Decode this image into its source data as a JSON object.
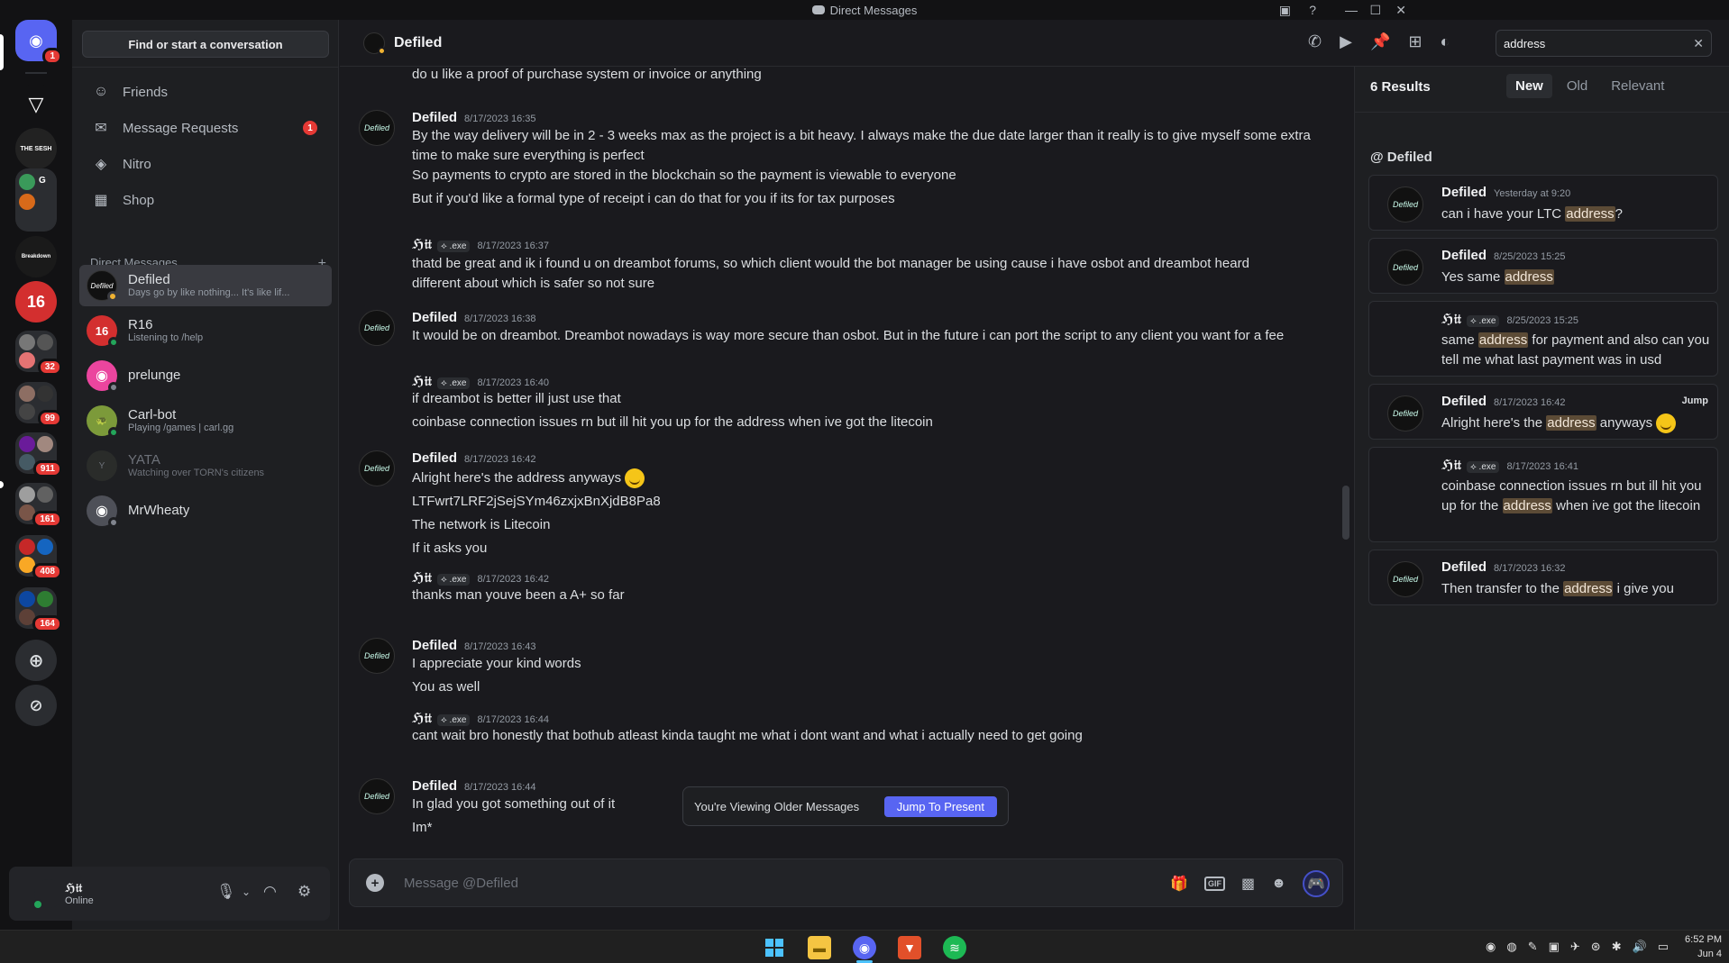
{
  "window": {
    "title": "Direct Messages"
  },
  "servers": [
    {
      "label": "THE SESH",
      "badge": ""
    },
    {
      "label": "G",
      "badge": ""
    },
    {
      "label": "Breakdown",
      "badge": ""
    },
    {
      "label": "16",
      "badge": ""
    },
    {
      "label": "",
      "badge": "32"
    },
    {
      "label": "",
      "badge": "99"
    },
    {
      "label": "",
      "badge": "911"
    },
    {
      "label": "",
      "badge": "161"
    },
    {
      "label": "",
      "badge": "408"
    },
    {
      "label": "",
      "badge": "164"
    }
  ],
  "home_badge": "1",
  "sidebar": {
    "find_placeholder": "Find or start a conversation",
    "nav": [
      {
        "label": "Friends",
        "count": ""
      },
      {
        "label": "Message Requests",
        "count": "1"
      },
      {
        "label": "Nitro",
        "count": ""
      },
      {
        "label": "Shop",
        "count": ""
      }
    ],
    "dm_header": "Direct Messages",
    "dms": [
      {
        "name": "Defiled",
        "sub": "Days go by like nothing... It's like lif..."
      },
      {
        "name": "R16",
        "sub": "Listening to /help"
      },
      {
        "name": "prelunge",
        "sub": ""
      },
      {
        "name": "Carl-bot",
        "sub": "Playing /games | carl.gg"
      },
      {
        "name": "YATA",
        "sub": "Watching over TORN's citizens"
      },
      {
        "name": "MrWheaty",
        "sub": ""
      }
    ]
  },
  "user": {
    "name": "ℌ𝔦𝔱",
    "status": "Online"
  },
  "chat": {
    "name": "Defiled",
    "search_value": "address",
    "top_line": "do u like a proof of purchase system or invoice or anything",
    "messages": [
      {
        "author": "Defiled",
        "tag": "",
        "time": "8/17/2023 16:35",
        "lines": [
          "By the way delivery will be in 2 - 3 weeks max as the project is a bit heavy. I always make the due date larger than it really is to give myself some extra time to make sure everything is perfect",
          "So payments to crypto are stored in the blockchain so the payment is viewable to everyone",
          "But if you'd like a formal type of receipt i can do that for you if its for tax purposes"
        ]
      },
      {
        "author": "ℌ𝔦𝔱",
        "tag": "⟡ .exe",
        "time": "8/17/2023 16:37",
        "lines": [
          "thatd be great and ik i found u on dreambot forums, so which client would the bot manager be using cause i have osbot and dreambot heard different about which is safer so not sure"
        ]
      },
      {
        "author": "Defiled",
        "tag": "",
        "time": "8/17/2023 16:38",
        "lines": [
          "It would be on dreambot. Dreambot nowadays is way more secure than osbot. But in the future i can port the script to any client you want for a fee"
        ]
      },
      {
        "author": "ℌ𝔦𝔱",
        "tag": "⟡ .exe",
        "time": "8/17/2023 16:40",
        "lines": [
          "if dreambot is better ill just use that",
          "coinbase connection issues rn but ill hit you up for the address when ive got the litecoin"
        ]
      },
      {
        "author": "Defiled",
        "tag": "",
        "time": "8/17/2023 16:42",
        "lines": [
          "Alright here's the address anyways",
          "LTFwrt7LRF2jSejSYm46zxjxBnXjdB8Pa8",
          "The network is Litecoin",
          "If it asks you"
        ]
      },
      {
        "author": "ℌ𝔦𝔱",
        "tag": "⟡ .exe",
        "time": "8/17/2023 16:42",
        "lines": [
          "thanks man youve been a A+ so far"
        ]
      },
      {
        "author": "Defiled",
        "tag": "",
        "time": "8/17/2023 16:43",
        "lines": [
          "I appreciate your kind words",
          "You as well"
        ]
      },
      {
        "author": "ℌ𝔦𝔱",
        "tag": "⟡ .exe",
        "time": "8/17/2023 16:44",
        "lines": [
          "cant wait bro honestly that bothub atleast kinda taught me what i dont want and what i actually need to get going"
        ]
      },
      {
        "author": "Defiled",
        "tag": "",
        "time": "8/17/2023 16:44",
        "lines": [
          "In glad you got something out of it",
          "Im*"
        ]
      }
    ],
    "older_text": "You're Viewing Older Messages",
    "jump_label": "Jump To Present",
    "composer_placeholder": "Message @Defiled",
    "gif_label": "GIF"
  },
  "results": {
    "count_label": "6 Results",
    "tabs": [
      "New",
      "Old",
      "Relevant"
    ],
    "group": "@ Defiled",
    "jump_label": "Jump",
    "items": [
      {
        "author": "Defiled",
        "tag": "",
        "time": "Yesterday at 9:20",
        "pre": "can i have your LTC ",
        "hl": "address",
        "post": "?"
      },
      {
        "author": "Defiled",
        "tag": "",
        "time": "8/25/2023 15:25",
        "pre": "Yes same ",
        "hl": "address",
        "post": ""
      },
      {
        "author": "ℌ𝔦𝔱",
        "tag": "⟡ .exe",
        "time": "8/25/2023 15:25",
        "pre": "same ",
        "hl": "address",
        "post": " for payment and also can you tell me what last payment was in usd"
      },
      {
        "author": "Defiled",
        "tag": "",
        "time": "8/17/2023 16:42",
        "pre": "Alright here's the ",
        "hl": "address",
        "post": " anyways"
      },
      {
        "author": "ℌ𝔦𝔱",
        "tag": "⟡ .exe",
        "time": "8/17/2023 16:41",
        "pre": "coinbase connection issues rn but ill hit you up for the ",
        "hl": "address",
        "post": " when ive got the litecoin"
      },
      {
        "author": "Defiled",
        "tag": "",
        "time": "8/17/2023 16:32",
        "pre": "Then transfer to the ",
        "hl": "address",
        "post": " i give you"
      }
    ]
  },
  "taskbar": {
    "time": "6:52 PM",
    "date": "Jun 4"
  },
  "colors": {
    "accent": "#5865f2",
    "badge": "#e53935",
    "online": "#23a55a",
    "highlight": "#5c4b36"
  },
  "avatar_text": "Defiled"
}
